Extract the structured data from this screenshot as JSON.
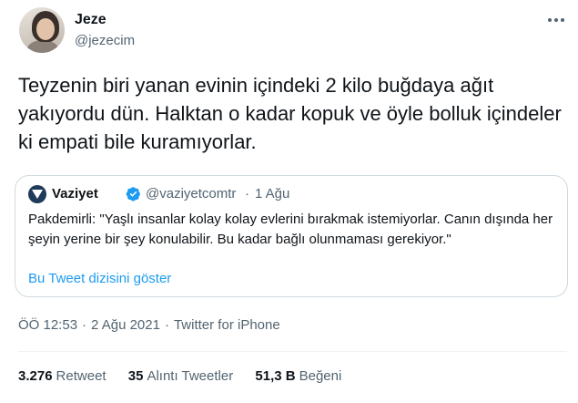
{
  "author": {
    "name": "Jeze",
    "handle": "@jezecim"
  },
  "tweet": {
    "text": "Teyzenin biri yanan evinin içindeki 2 kilo buğdaya ağıt yakıyordu dün. Halktan o kadar kopuk ve öyle bolluk içindeler ki empati bile kuramıyorlar.",
    "time": "ÖÖ 12:53",
    "separator": "·",
    "date": "2 Ağu 2021",
    "source": "Twitter for iPhone"
  },
  "quote": {
    "name": "Vaziyet",
    "handle": "@vaziyetcomtr",
    "separator": "·",
    "time": "1 Ağu",
    "text": "Pakdemirli: \"Yaşlı insanlar kolay kolay evlerini bırakmak istemiyorlar. Canın dışında her şeyin yerine bir şey konulabilir. Bu kadar bağlı olunmaması gerekiyor.\"",
    "thread_link": "Bu Tweet dizisini göster"
  },
  "stats": [
    {
      "count": "3.276",
      "label": "Retweet"
    },
    {
      "count": "35",
      "label": "Alıntı Tweetler"
    },
    {
      "count": "51,3 B",
      "label": "Beğeni"
    }
  ],
  "colors": {
    "accent": "#1d9bf0",
    "text": "#0f1419",
    "secondary": "#536471",
    "border": "#cfd9de"
  },
  "icons": {
    "more": "more-horizontal-icon",
    "verified": "verified-badge-icon"
  }
}
